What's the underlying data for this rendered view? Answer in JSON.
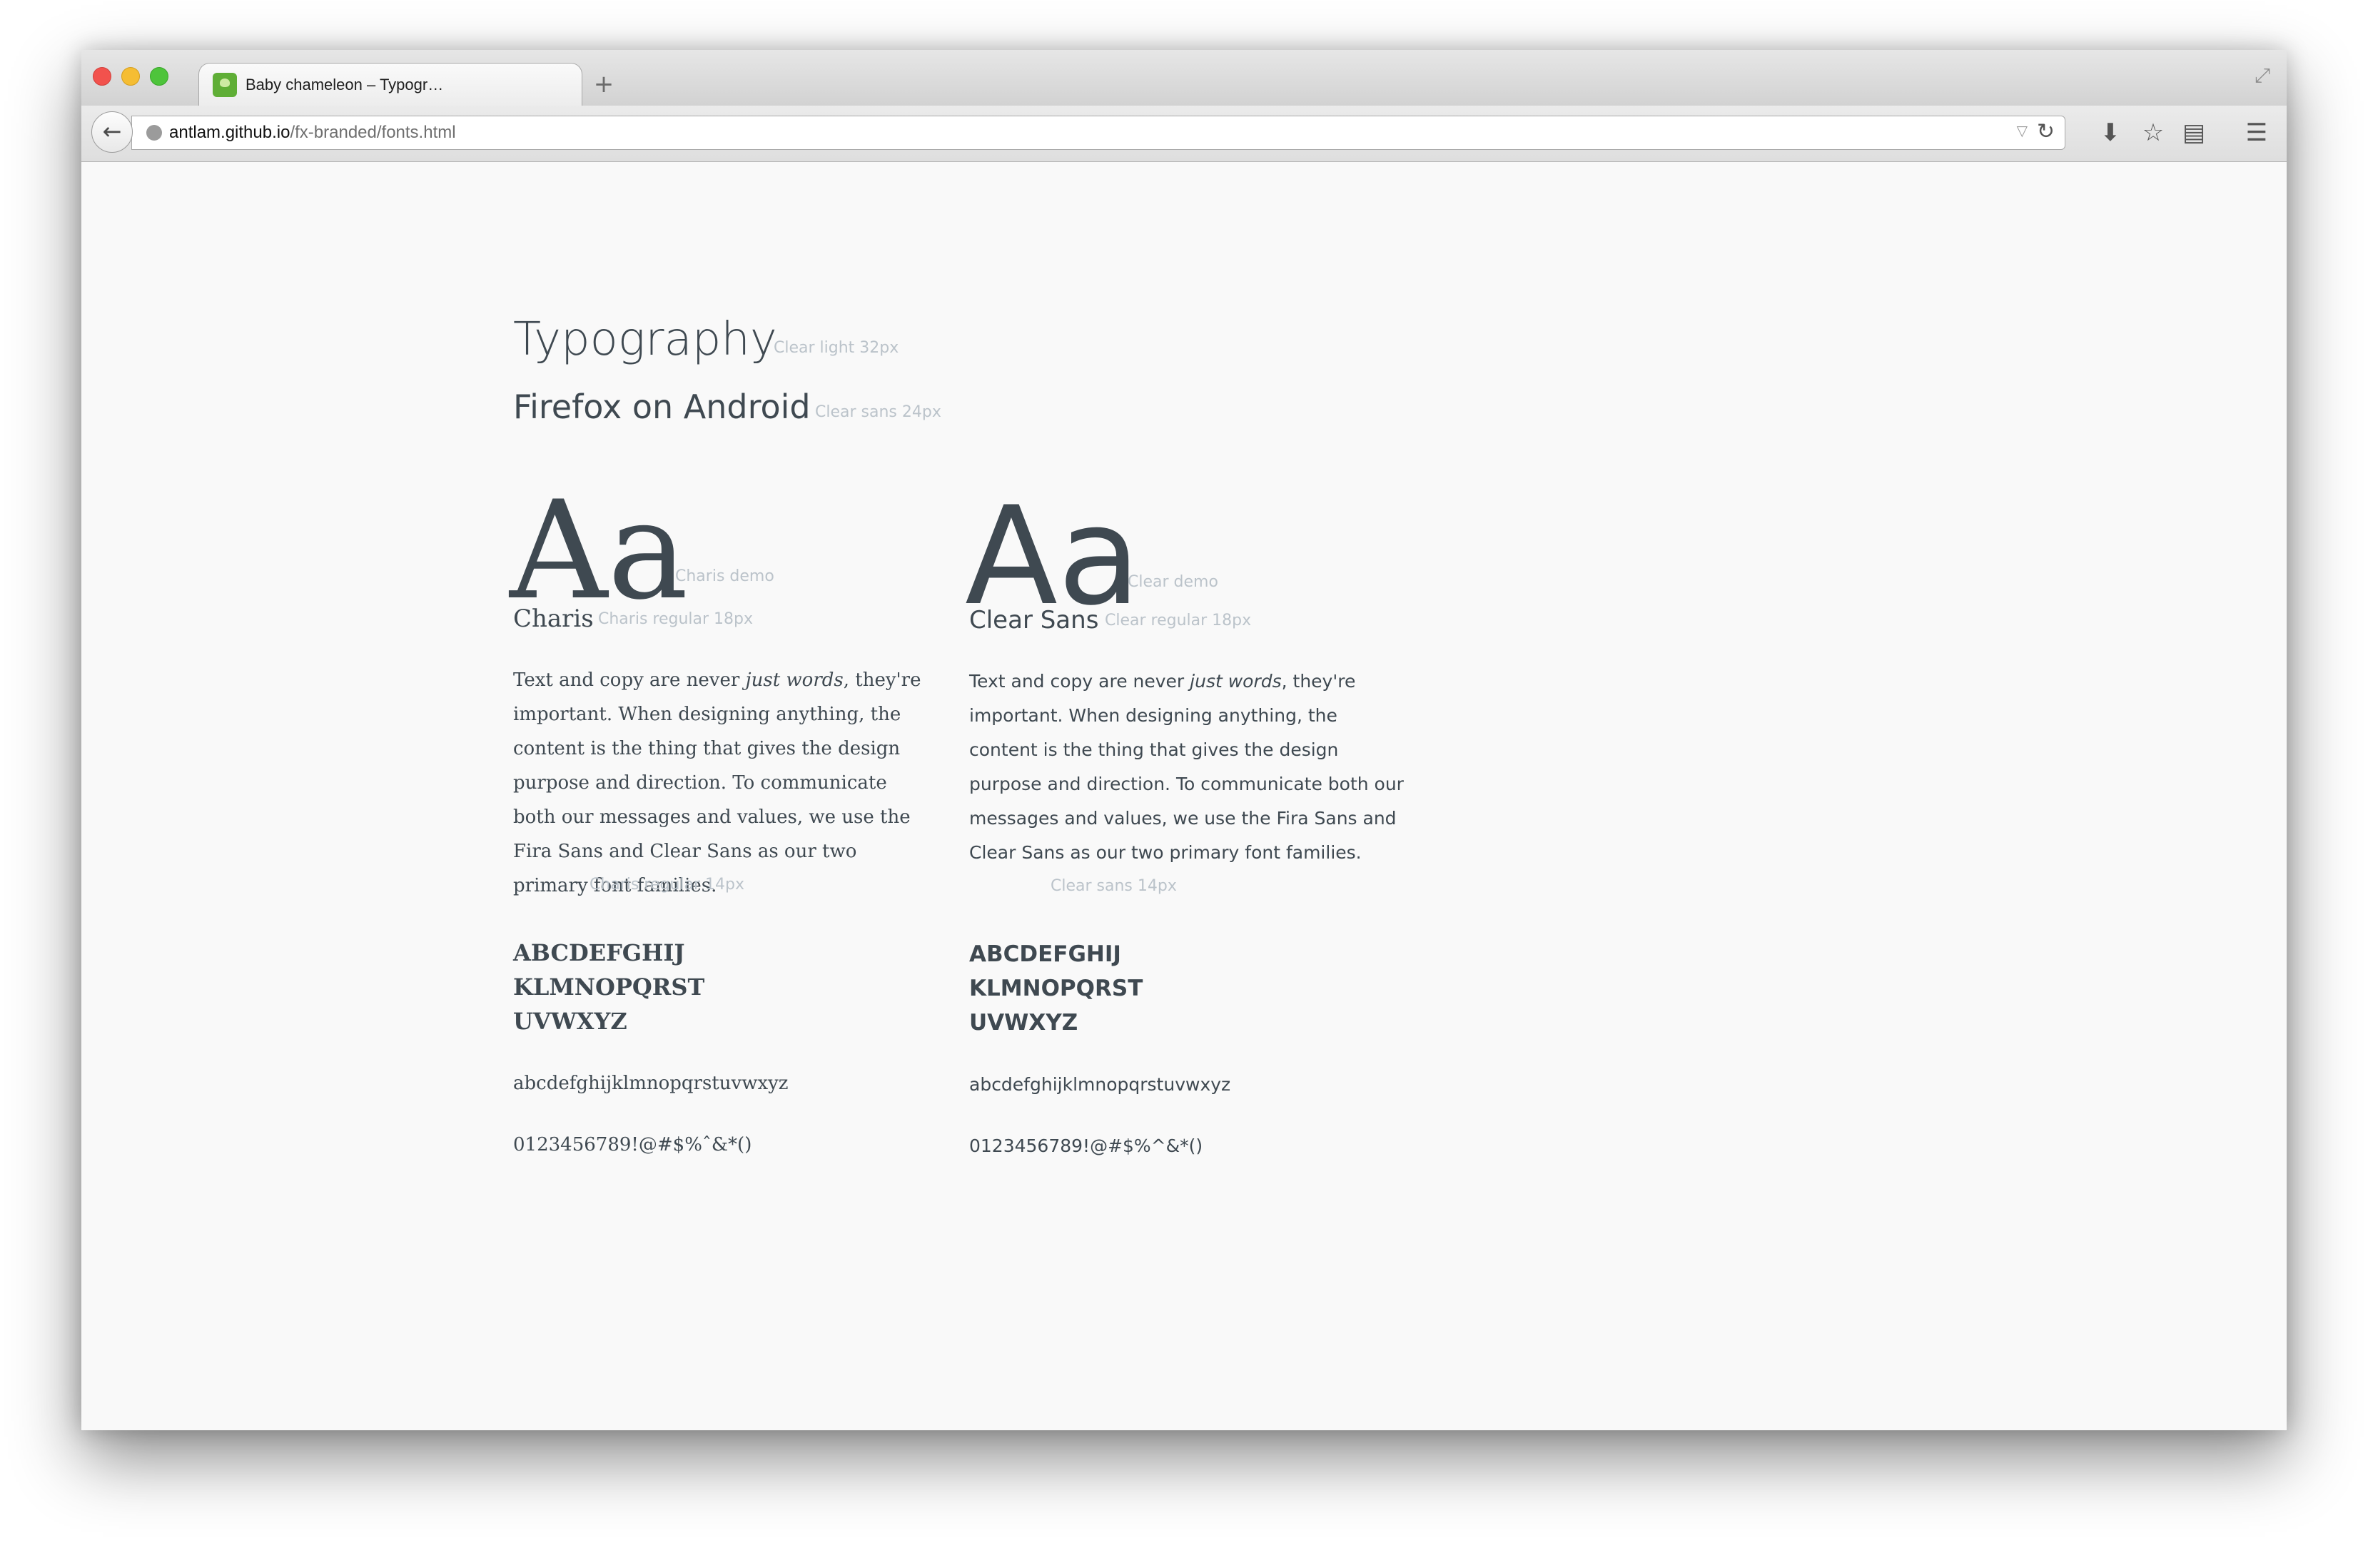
{
  "browser": {
    "tab_title": "Baby chameleon – Typogr…",
    "new_tab_label": "+",
    "url_host": "antlam.github.io",
    "url_path": "/fx-branded/fonts.html"
  },
  "page": {
    "title": "Typography",
    "title_note": "Clear light 32px",
    "subtitle": "Firefox on Android",
    "subtitle_note": "Clear sans 24px",
    "columns": [
      {
        "demo_glyph": "Aa",
        "demo_note": "Charis demo",
        "font_name": "Charis",
        "font_note": "Charis regular 18px",
        "para_before": "Text and copy are never ",
        "para_em": "just words",
        "para_after": ", they're important. When designing anything, the content is the thing that gives the design purpose and direction. To communicate both our messages and values, we use the Fira Sans and Clear Sans as our two primary font families.",
        "para_note": "Charis regular 14px",
        "upper_lines": [
          "ABCDEFGHIJ",
          "KLMNOPQRST",
          "UVWXYZ"
        ],
        "lower": "abcdefghijklmnopqrstuvwxyz",
        "digits": "0123456789!@#$%ˆ&*()"
      },
      {
        "demo_glyph": "Aa",
        "demo_note": "Clear demo",
        "font_name": "Clear Sans",
        "font_note": "Clear regular 18px",
        "para_before": "Text and copy are never ",
        "para_em": "just words",
        "para_after": ", they're important. When designing anything, the content is the thing that gives the design purpose and direction. To communicate both our messages and values, we use the Fira Sans and Clear Sans as our two primary font families.",
        "para_note": "Clear sans 14px",
        "upper_lines": [
          "ABCDEFGHIJ",
          "KLMNOPQRST",
          "UVWXYZ"
        ],
        "lower": "abcdefghijklmnopqrstuvwxyz",
        "digits": "0123456789!@#$%^&*()"
      }
    ]
  },
  "colors": {
    "text": "#3f4951",
    "note": "#bbc3ca",
    "background": "#f9f9f9"
  },
  "icons": {
    "traffic_lights": [
      "close-icon",
      "minimize-icon",
      "zoom-icon"
    ],
    "nav": [
      "back-arrow-icon",
      "globe-icon",
      "dropdown-icon",
      "reload-icon",
      "download-icon",
      "bookmark-star-icon",
      "reading-list-icon",
      "menu-icon"
    ]
  }
}
